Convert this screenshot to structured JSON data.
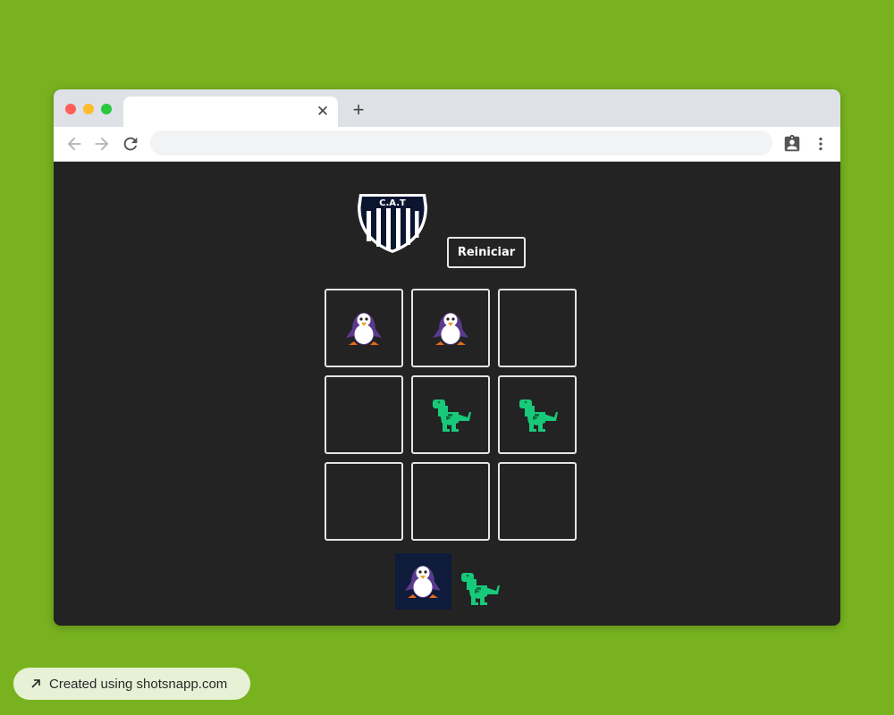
{
  "browser": {
    "tab_title": "",
    "tab_close_glyph": "✕",
    "new_tab_glyph": "+",
    "address_value": "",
    "icons": [
      "back-arrow-icon",
      "forward-arrow-icon",
      "reload-icon",
      "clipboard-account-icon",
      "more-vert-icon"
    ]
  },
  "game": {
    "logo_text": "C.A.T",
    "reset_label": "Reiniciar",
    "board": [
      "penguin",
      "penguin",
      "",
      "",
      "dino",
      "dino",
      "",
      "",
      ""
    ],
    "current_turn": "penguin",
    "players": [
      "penguin",
      "dino"
    ]
  },
  "colors": {
    "page_bg": "#78b31f",
    "content_bg": "#232323",
    "cell_border": "#e4e4e4",
    "turn_highlight": "#0e1b3a",
    "dino": "#19c97a",
    "penguin_body": "#5b3a8c"
  },
  "footer": {
    "text": "Created using shotsnapp.com"
  }
}
